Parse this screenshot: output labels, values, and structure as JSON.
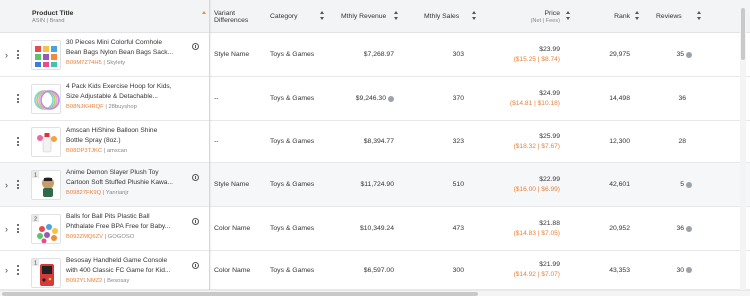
{
  "header": {
    "product_title": "Product Title",
    "product_title_sub": "ASIN | Brand",
    "variant_line1": "Variant",
    "variant_line2": "Differences",
    "category": "Category",
    "revenue": "Mthly Revenue",
    "sales": "Mthly Sales",
    "price": "Price",
    "price_sub": "(Net | Fees)",
    "rank": "Rank",
    "reviews": "Reviews"
  },
  "rows": [
    {
      "expand": "›",
      "title_line1": "30 Pieces Mini Colorful Cornhole",
      "title_line2": "Bean Bags Nylon Bean Bags Sack...",
      "asin": "B09M7Z74H5",
      "sep": " | ",
      "brand": "Skylety",
      "variant": "Style Name",
      "category": "Toys & Games",
      "revenue": "$7,268.97",
      "sales": "303",
      "price": "$23.99",
      "fees": "($15.25 | $8.74)",
      "rank": "29,975",
      "reviews": "35",
      "highlight": false
    },
    {
      "expand": "",
      "title_line1": "4 Pack Kids Exercise Hoop for Kids,",
      "title_line2": "Size Adjustable & Detachable...",
      "asin": "B08NJKHRQF",
      "sep": " | ",
      "brand": "28buyshop",
      "variant": "--",
      "category": "Toys & Games",
      "revenue": "$9,246.30",
      "sales": "370",
      "price": "$24.99",
      "fees": "($14.81 | $10.18)",
      "rank": "14,498",
      "reviews": "36",
      "highlight": false
    },
    {
      "expand": "",
      "title_line1": "Amscan HiShine Balloon Shine",
      "title_line2": "Bottle Spray (8oz.)",
      "asin": "B08DP3TJKC",
      "sep": " | ",
      "brand": "amscan",
      "variant": "--",
      "category": "Toys & Games",
      "revenue": "$8,394.77",
      "sales": "323",
      "price": "$25.99",
      "fees": "($18.32 | $7.67)",
      "rank": "12,300",
      "reviews": "28",
      "highlight": false
    },
    {
      "expand": "›",
      "badge": "1",
      "title_line1": "Anime Demon Slayer Plush Toy",
      "title_line2": "Cartoon Soft Stuffed Plushie Kawa...",
      "asin": "B09827FK9Q",
      "sep": " | ",
      "brand": "Yanrianjr",
      "variant": "Style Name",
      "category": "Toys & Games",
      "revenue": "$11,724.90",
      "sales": "510",
      "price": "$22.99",
      "fees": "($16.00 | $6.99)",
      "rank": "42,601",
      "reviews": "5",
      "highlight": true
    },
    {
      "expand": "›",
      "badge": "2",
      "title_line1": "Balls for Ball Pits Plastic Ball",
      "title_line2": "Phthalate Free BPA Free for Baby...",
      "asin": "B092ZMQ6ZV",
      "sep": " | ",
      "brand": "GOGOSO",
      "variant": "Color Name",
      "category": "Toys & Games",
      "revenue": "$10,349.24",
      "sales": "473",
      "price": "$21.88",
      "fees": "($14.83 | $7.05)",
      "rank": "20,952",
      "reviews": "36",
      "highlight": false
    },
    {
      "expand": "›",
      "badge": "1",
      "title_line1": "Besosay Handheld Game Console",
      "title_line2": "with 400 Classic FC Game for Kid...",
      "asin": "B092YLNMZ2",
      "sep": " | ",
      "brand": "Besosay",
      "variant": "Color Name",
      "category": "Toys & Games",
      "revenue": "$6,597.00",
      "sales": "300",
      "price": "$21.99",
      "fees": "($14.92 | $7.07)",
      "rank": "43,353",
      "reviews": "30",
      "highlight": false
    }
  ],
  "colors": {
    "accent_orange": "#e8823a",
    "header_bg": "#f3f4f6"
  }
}
